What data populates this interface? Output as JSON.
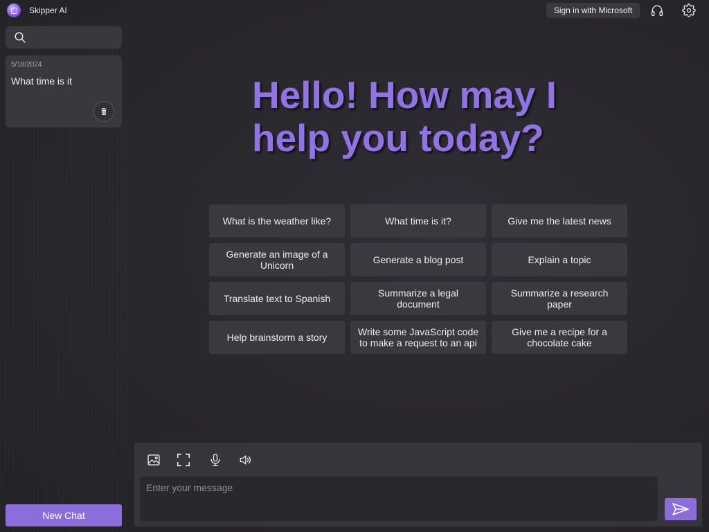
{
  "app": {
    "title": "Skipper AI",
    "logo_icon": "app-logo-icon"
  },
  "header": {
    "signin_label": "Sign in with Microsoft",
    "icons": [
      "headset-icon",
      "gear-icon"
    ]
  },
  "sidebar": {
    "search_icon": "search-icon",
    "chats": [
      {
        "date": "5/18/2024",
        "title": "What time is it",
        "delete_icon": "trash-icon"
      }
    ],
    "new_chat_label": "New Chat"
  },
  "hero": {
    "line1": "Hello! How may I",
    "line2": "help you today?"
  },
  "suggestions": [
    "What is the weather like?",
    "What time is it?",
    "Give me the latest news",
    "Generate an image of a Unicorn",
    "Generate a blog post",
    "Explain a topic",
    "Translate text to Spanish",
    "Summarize a legal document",
    "Summarize a research paper",
    "Help brainstorm a story",
    "Write some JavaScript code to make a request to an api",
    "Give me a recipe for a chocolate cake"
  ],
  "composer": {
    "placeholder": "Enter your message",
    "tools": [
      "image-upload-icon",
      "fullscreen-icon",
      "microphone-icon",
      "speaker-icon"
    ],
    "send_icon": "send-icon"
  },
  "colors": {
    "accent": "#8b6ddb",
    "hero_text": "#9273e6",
    "panel": "#39383e",
    "background": "#29282d"
  }
}
